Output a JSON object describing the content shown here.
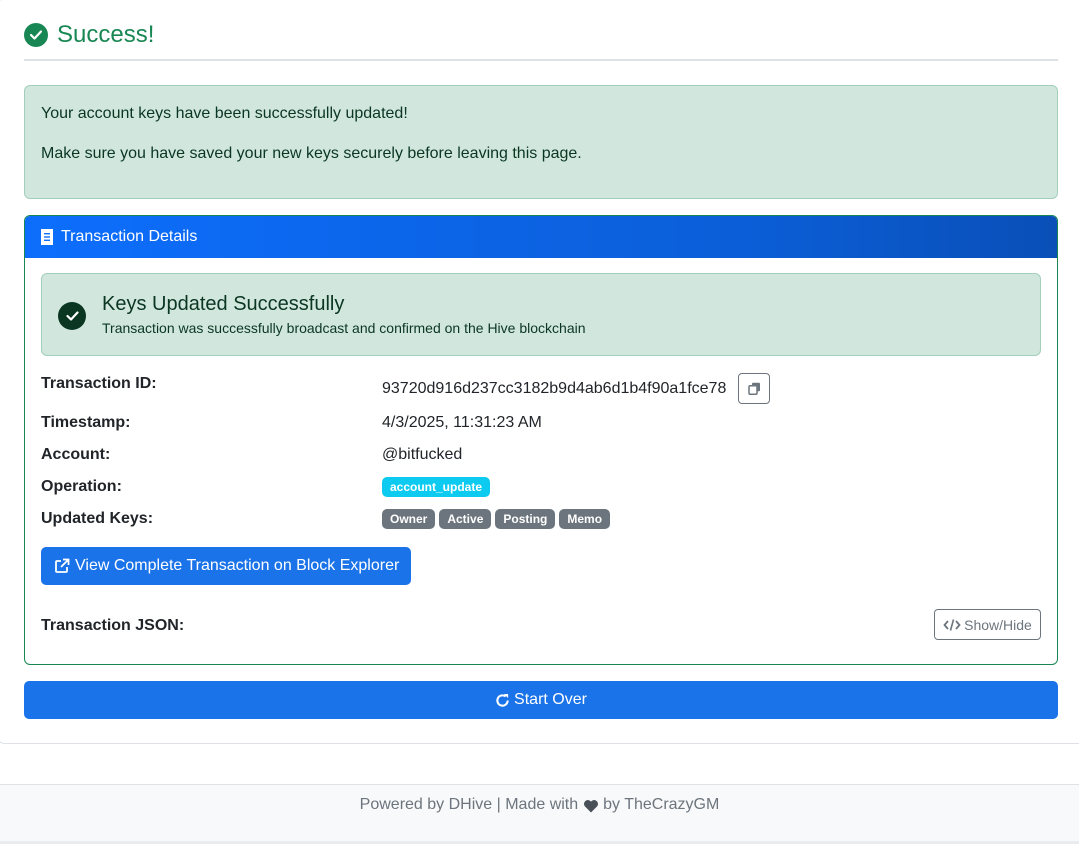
{
  "header": {
    "title": "Success!",
    "icon": "check-circle-icon"
  },
  "alert": {
    "line1": "Your account keys have been successfully updated!",
    "line2": "Make sure you have saved your new keys securely before leaving this page."
  },
  "transaction_card": {
    "header_title": "Transaction Details",
    "status_title": "Keys Updated Successfully",
    "status_subtitle": "Transaction was successfully broadcast and confirmed on the Hive blockchain",
    "rows": [
      {
        "label": "Transaction ID:",
        "value": "93720d916d237cc3182b9d4ab6d1b4f90a1fce78"
      },
      {
        "label": "Timestamp:",
        "value": "4/3/2025, 11:31:23 AM"
      },
      {
        "label": "Account:",
        "value": "@bitfucked"
      },
      {
        "label": "Operation:",
        "value": "account_update"
      },
      {
        "label": "Updated Keys:",
        "value": ""
      }
    ],
    "updated_keys": [
      "Owner",
      "Active",
      "Posting",
      "Memo"
    ],
    "explorer_button": "View Complete Transaction on Block Explorer",
    "json_label": "Transaction JSON:",
    "show_hide_button": "Show/Hide"
  },
  "start_over_button": "Start Over",
  "footer": {
    "left": "Powered by DHive | Made with",
    "right": "by TheCrazyGM"
  },
  "colors": {
    "success": "#198754",
    "primary": "#1a73e8",
    "info": "#0dcaf0",
    "secondary": "#6c757d"
  }
}
